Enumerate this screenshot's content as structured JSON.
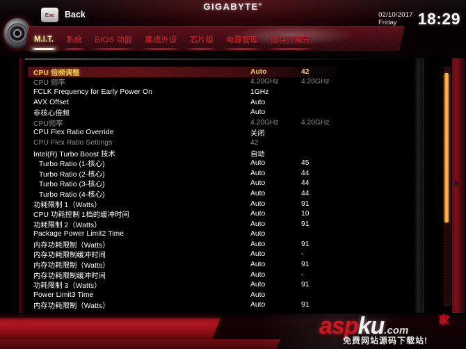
{
  "brand": {
    "logo_text": "GIGABYTE",
    "logo_tm": "®",
    "emblem_name": "gigabyte-gear-emblem"
  },
  "datetime": {
    "date": "02/10/2017",
    "weekday": "Friday",
    "time": "18:29"
  },
  "nav": {
    "tabs": [
      {
        "label": "M.I.T.",
        "active": true
      },
      {
        "label": "系统",
        "active": false
      },
      {
        "label": "BIOS 功能",
        "active": false
      },
      {
        "label": "集成外设",
        "active": false
      },
      {
        "label": "芯片组",
        "active": false
      },
      {
        "label": "电源管理",
        "active": false
      },
      {
        "label": "储存并离开",
        "active": false
      }
    ]
  },
  "settings": {
    "rows": [
      {
        "label": "CPU 倍频调整",
        "v1": "Auto",
        "v2": "42",
        "state": "selected",
        "indent": false
      },
      {
        "label": "CPU 频率",
        "v1": "4.20GHz",
        "v2": "4.20GHz",
        "state": "dim",
        "indent": false
      },
      {
        "label": "FCLK Frequency for Early Power On",
        "v1": "1GHz",
        "v2": "",
        "state": "white",
        "indent": false
      },
      {
        "label": "AVX Offset",
        "v1": "Auto",
        "v2": "",
        "state": "white",
        "indent": false
      },
      {
        "label": "非核心倍频",
        "v1": "Auto",
        "v2": "",
        "state": "white",
        "indent": false
      },
      {
        "label": "CPU频率",
        "v1": "4.20GHz",
        "v2": "4.20GHz",
        "state": "dim",
        "indent": false
      },
      {
        "label": "CPU Flex Ratio Override",
        "v1": "关闭",
        "v2": "",
        "state": "white",
        "indent": false
      },
      {
        "label": "CPU Flex Ratio Settings",
        "v1": "42",
        "v2": "",
        "state": "dim",
        "indent": false
      },
      {
        "label": "Intel(R) Turbo Boost 技术",
        "v1": "自动",
        "v2": "",
        "state": "white",
        "indent": false
      },
      {
        "label": "Turbo Ratio (1-核心)",
        "v1": "Auto",
        "v2": "45",
        "state": "white",
        "indent": true
      },
      {
        "label": "Turbo Ratio (2-核心)",
        "v1": "Auto",
        "v2": "44",
        "state": "white",
        "indent": true
      },
      {
        "label": "Turbo Ratio (3-核心)",
        "v1": "Auto",
        "v2": "44",
        "state": "white",
        "indent": true
      },
      {
        "label": "Turbo Ratio (4-核心)",
        "v1": "Auto",
        "v2": "44",
        "state": "white",
        "indent": true
      },
      {
        "label": "功耗限制 1（Watts）",
        "v1": "Auto",
        "v2": "91",
        "state": "white",
        "indent": false
      },
      {
        "label": "CPU 功耗控制 1档的缓冲时间",
        "v1": "Auto",
        "v2": "10",
        "state": "white",
        "indent": false
      },
      {
        "label": "功耗限制 2（Watts）",
        "v1": "Auto",
        "v2": "91",
        "state": "white",
        "indent": false
      },
      {
        "label": "Package Power Limit2 Time",
        "v1": "Auto",
        "v2": "",
        "state": "white",
        "indent": false
      },
      {
        "label": "内存功耗限制（Watts）",
        "v1": "Auto",
        "v2": "91",
        "state": "white",
        "indent": false
      },
      {
        "label": "内存功耗限制缓冲时间",
        "v1": "Auto",
        "v2": "-",
        "state": "white",
        "indent": false
      },
      {
        "label": "内存功耗限制（Watts）",
        "v1": "Auto",
        "v2": "91",
        "state": "white",
        "indent": false
      },
      {
        "label": "内存功耗限制缓冲时间",
        "v1": "Auto",
        "v2": "-",
        "state": "white",
        "indent": false
      },
      {
        "label": "功耗限制 3（Watts）",
        "v1": "Auto",
        "v2": "91",
        "state": "white",
        "indent": false
      },
      {
        "label": "Power Limit3 Time",
        "v1": "Auto",
        "v2": "",
        "state": "white",
        "indent": false
      },
      {
        "label": "内存功耗限制（Watts）",
        "v1": "Auto",
        "v2": "91",
        "state": "white",
        "indent": false
      }
    ]
  },
  "footer": {
    "esc_key": "Esc",
    "back_label": "Back"
  },
  "watermark": {
    "part1": "asp",
    "part2": "ku",
    "part3": ".com",
    "seal": "家",
    "subtitle": "免费网站源码下载站!"
  },
  "colors": {
    "accent_red": "#b2151e",
    "highlight_gold": "#e9c24a",
    "scrollbar_orange": "#ffae3a",
    "dim_text": "#8d8d8d"
  }
}
